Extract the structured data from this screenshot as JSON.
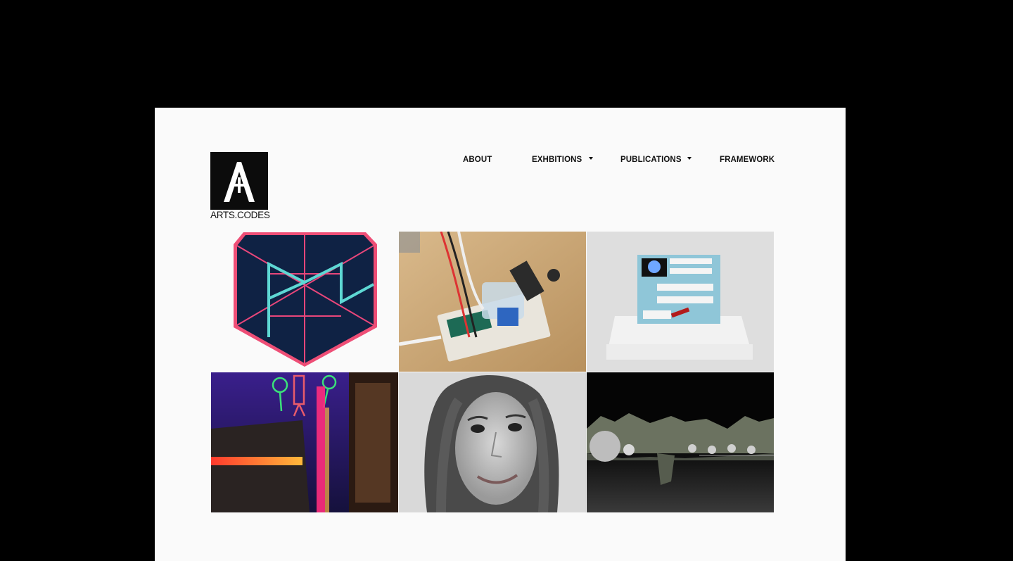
{
  "site": {
    "logo_letter": "A",
    "logo_text": "ARTS.CODES"
  },
  "nav": {
    "items": [
      {
        "label": "ABOUT",
        "has_dropdown": false
      },
      {
        "label": "EXHBITIONS",
        "has_dropdown": true
      },
      {
        "label": "PUBLICATIONS",
        "has_dropdown": true
      },
      {
        "label": "FRAMEWORK",
        "has_dropdown": false
      }
    ]
  },
  "gallery": {
    "tiles": [
      {
        "name": "hexagon-logo-artwork"
      },
      {
        "name": "breadboard-circuit-photo"
      },
      {
        "name": "automaton-panel-on-pedestal"
      },
      {
        "name": "neon-installation-window"
      },
      {
        "name": "artist-portrait-bw"
      },
      {
        "name": "3d-mountain-landscape-render"
      }
    ]
  },
  "colors": {
    "page_background": "#fafafa",
    "outer_background": "#000000",
    "text": "#111111"
  }
}
